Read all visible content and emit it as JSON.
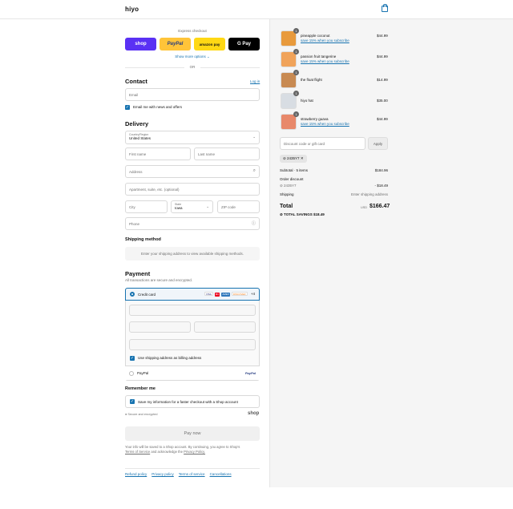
{
  "header": {
    "logo": "hiyo"
  },
  "express": {
    "title": "Express checkout",
    "shop": "shop",
    "paypal": "PayPal",
    "amazon": "amazon pay",
    "gpay": "G Pay",
    "more": "Show more options",
    "or": "OR"
  },
  "contact": {
    "title": "Contact",
    "login": "Log in",
    "email_placeholder": "Email",
    "news": "Email me with news and offers"
  },
  "delivery": {
    "title": "Delivery",
    "country_label": "Country/Region",
    "country_value": "United States",
    "first": "First name",
    "last": "Last name",
    "address": "Address",
    "apt": "Apartment, suite, etc. (optional)",
    "city": "City",
    "state_label": "State",
    "state_value": "Iowa",
    "zip": "ZIP code",
    "phone": "Phone"
  },
  "shipping": {
    "title": "Shipping method",
    "note": "Enter your shipping address to view available shipping methods."
  },
  "payment": {
    "title": "Payment",
    "subtitle": "All transactions are secure and encrypted.",
    "credit": "Credit card",
    "more_cards": "+4",
    "billing": "Use shipping address as billing address",
    "paypal": "PayPal",
    "cards": [
      "VISA",
      "MC",
      "AMEX",
      "DISCOVER"
    ]
  },
  "remember": {
    "title": "Remember me",
    "save": "Save my information for a faster checkout with a Shop account",
    "secure": "Secure and encrypted",
    "shop": "shop"
  },
  "paynow": "Pay now",
  "legal": {
    "text1": "Your info will be saved to a Shop account. By continuing, you agree to Shop's",
    "tos": "Terms of Service",
    "text2": "and acknowledge the",
    "privacy": "Privacy Policy."
  },
  "footer": [
    "Refund policy",
    "Privacy policy",
    "Terms of service",
    "Cancellations"
  ],
  "items": [
    {
      "name": "pineapple coconut",
      "sub": "save 15% when you subscribe",
      "price": "$44.99",
      "qty": "1",
      "color": "#e89a3c"
    },
    {
      "name": "passion fruit tangerine",
      "sub": "save 15% when you subscribe",
      "price": "$44.99",
      "qty": "1",
      "color": "#f0a35a"
    },
    {
      "name": "the float flight",
      "sub": "",
      "price": "$14.99",
      "qty": "1",
      "color": "#c88a52"
    },
    {
      "name": "hiyo hat",
      "sub": "",
      "price": "$35.00",
      "qty": "1",
      "color": "#b8c4d0"
    },
    {
      "name": "strawberry guava",
      "sub": "save 15% when you subscribe",
      "price": "$44.99",
      "qty": "1",
      "color": "#e8886a"
    }
  ],
  "discount": {
    "placeholder": "Discount code or gift card",
    "apply": "Apply",
    "code": "2435Y7"
  },
  "summary": {
    "subtotal_label": "Subtotal · 5 items",
    "subtotal": "$184.96",
    "order_discount": "Order discount",
    "code": "2435Y7",
    "discount": "- $18.49",
    "shipping_label": "Shipping",
    "shipping": "Enter shipping address",
    "total_label": "Total",
    "currency": "USD",
    "total": "$166.47",
    "savings_label": "TOTAL SAVINGS",
    "savings": "$18.49"
  }
}
